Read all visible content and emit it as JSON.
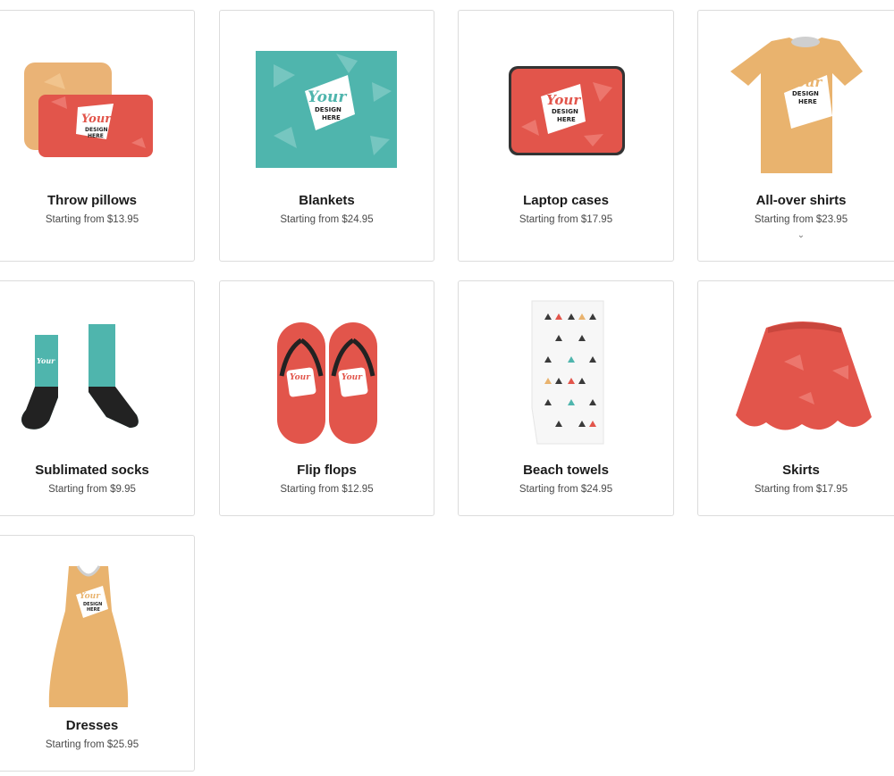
{
  "products": [
    {
      "title": "Throw pillows",
      "price": "Starting from $13.95",
      "image": "throw-pillows-image"
    },
    {
      "title": "Blankets",
      "price": "Starting from $24.95",
      "image": "blanket-image"
    },
    {
      "title": "Laptop cases",
      "price": "Starting from $17.95",
      "image": "laptop-case-image"
    },
    {
      "title": "All-over shirts",
      "price": "Starting from $23.95",
      "image": "all-over-shirt-image"
    },
    {
      "title": "Sublimated socks",
      "price": "Starting from $9.95",
      "image": "socks-image"
    },
    {
      "title": "Flip flops",
      "price": "Starting from $12.95",
      "image": "flip-flops-image"
    },
    {
      "title": "Beach towels",
      "price": "Starting from $24.95",
      "image": "beach-towel-image"
    },
    {
      "title": "Skirts",
      "price": "Starting from $17.95",
      "image": "skirt-image"
    },
    {
      "title": "Dresses",
      "price": "Starting from $25.95",
      "image": "dress-image"
    }
  ],
  "mockup_text": {
    "line1": "Your",
    "line2": "DESIGN",
    "line3": "HERE"
  },
  "colors": {
    "coral": "#e2554b",
    "teal": "#4fb5ad",
    "sand": "#e9b36e",
    "border": "#dcdcdc"
  }
}
